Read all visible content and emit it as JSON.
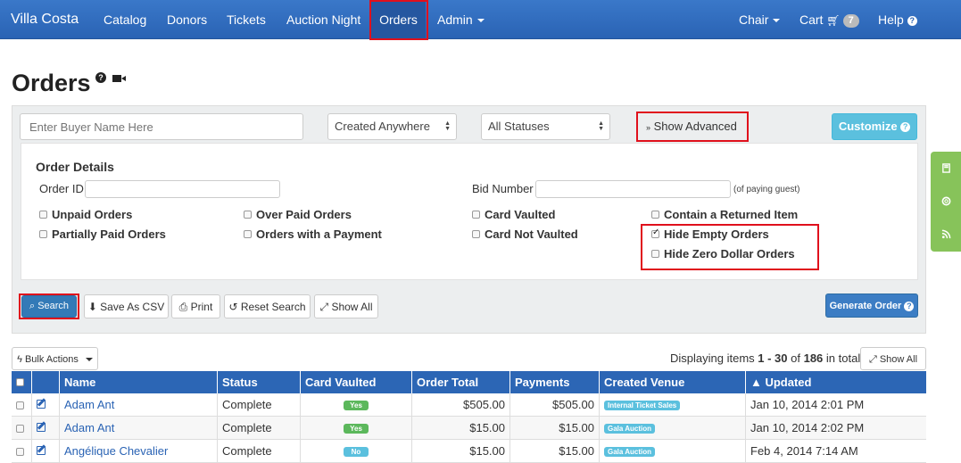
{
  "navbar": {
    "brand": "Villa Costa",
    "left_items": [
      "Catalog",
      "Donors",
      "Tickets",
      "Auction Night",
      "Orders",
      "Admin"
    ],
    "right_items": {
      "chair": "Chair",
      "cart": "Cart",
      "cart_count": "7",
      "help": "Help"
    }
  },
  "page": {
    "title": "Orders"
  },
  "filters": {
    "buyer_placeholder": "Enter Buyer Name Here",
    "created_select": "Created Anywhere",
    "status_select": "All Statuses",
    "show_advanced": "Show Advanced",
    "customize": "Customize"
  },
  "advanced": {
    "section_title": "Order Details",
    "order_id_label": "Order ID",
    "bid_number_label": "Bid Number",
    "bid_number_note": "(of paying guest)",
    "checkboxes": [
      {
        "label": "Unpaid Orders",
        "checked": false
      },
      {
        "label": "Over Paid Orders",
        "checked": false
      },
      {
        "label": "Card Vaulted",
        "checked": false
      },
      {
        "label": "Contain a Returned Item",
        "checked": false
      },
      {
        "label": "Partially Paid Orders",
        "checked": false
      },
      {
        "label": "Orders with a Payment",
        "checked": false
      },
      {
        "label": "Card Not Vaulted",
        "checked": false
      },
      {
        "label": "Hide Empty Orders",
        "checked": true
      },
      {
        "label": "Hide Zero Dollar Orders",
        "checked": false
      }
    ]
  },
  "actions": {
    "search": "Search",
    "save_csv": "Save As CSV",
    "print": "Print",
    "reset": "Reset Search",
    "show_all": "Show All",
    "generate_order": "Generate Order"
  },
  "table_controls": {
    "bulk_actions": "Bulk Actions",
    "display_prefix": "Displaying items ",
    "display_range": "1 - 30",
    "display_mid": " of ",
    "display_total": "186",
    "display_suffix": " in total",
    "show_all": "Show All"
  },
  "table": {
    "columns": [
      "Name",
      "Status",
      "Card Vaulted",
      "Order Total",
      "Payments",
      "Created Venue",
      "▲ Updated"
    ],
    "rows": [
      {
        "name": "Adam Ant",
        "status": "Complete",
        "card_vaulted": "Yes",
        "order_total": "$505.00",
        "payments": "$505.00",
        "venue": "Internal Ticket Sales",
        "updated": "Jan 10, 2014 2:01 PM"
      },
      {
        "name": "Adam Ant",
        "status": "Complete",
        "card_vaulted": "Yes",
        "order_total": "$15.00",
        "payments": "$15.00",
        "venue": "Gala Auction",
        "updated": "Jan 10, 2014 2:02 PM"
      },
      {
        "name": "Angélique Chevalier",
        "status": "Complete",
        "card_vaulted": "No",
        "order_total": "$15.00",
        "payments": "$15.00",
        "venue": "Gala Auction",
        "updated": "Feb 4, 2014 7:14 AM"
      }
    ]
  },
  "colors": {
    "navbar": "#2a63b4",
    "highlight": "#e0101c",
    "side_tab": "#87c35a",
    "yes": "#5cb85c",
    "no": "#5bc0de"
  },
  "side_tabs": {
    "icons": [
      "book-icon",
      "lifebuoy-icon",
      "rss-icon"
    ]
  }
}
